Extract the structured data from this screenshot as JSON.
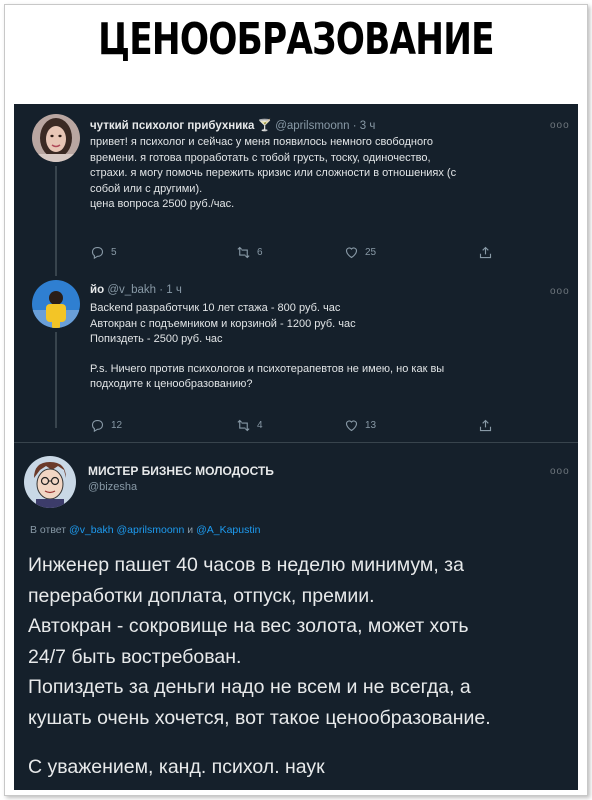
{
  "header": {
    "title": "ЦЕНООБРАЗОВАНИЕ"
  },
  "tweets": [
    {
      "name": "чуткий психолог прибухника",
      "emoji": "🍸",
      "handle": "@aprilsmoonn",
      "time": "· 3 ч",
      "lines": [
        "привет! я психолог и сейчас у меня появилось немного свободного",
        "времени. я готова проработать с тобой грусть, тоску, одиночество,",
        "страхи. я могу помочь пережить кризис или сложности в отношениях (с",
        "собой или с другими).",
        "цена вопроса 2500 руб./час."
      ],
      "replies": "5",
      "retweets": "6",
      "likes": "25"
    },
    {
      "name": "йо",
      "handle": "@v_bakh",
      "time": "· 1 ч",
      "lines": [
        "Backend разработчик 10 лет стажа - 800 руб. час",
        "Автокран с подъемником и корзиной - 1200 руб. час",
        "Попиздеть - 2500 руб. час",
        "",
        "P.s. Ничего против психологов и психотерапевтов не имею, но как вы",
        "подходите к ценообразованию?"
      ],
      "replies": "12",
      "retweets": "4",
      "likes": "13"
    }
  ],
  "main_tweet": {
    "name": "МИСТЕР БИЗНЕС МОЛОДОСТЬ",
    "handle": "@bizesha",
    "reply_prefix": "В ответ",
    "reply_m1": "@v_bakh",
    "reply_m2": "@aprilsmoonn",
    "reply_and": "и",
    "reply_m3": "@A_Kapustin",
    "lines": [
      "Инженер пашет 40 часов в неделю минимум, за",
      "переработки доплата, отпуск, премии.",
      "Автокран - сокровище на вес золота, может хоть",
      "24/7 быть востребован.",
      "Попиздеть за деньги надо не всем и не всегда, а",
      "кушать очень хочется, вот такое ценообразование."
    ],
    "signature": "С уважением, канд. психол. наук"
  },
  "more_label": "ooo",
  "colors": {
    "background": "#15202b",
    "accent": "#1d9bf0",
    "muted": "#8899a6",
    "text": "#e7e9ea"
  }
}
